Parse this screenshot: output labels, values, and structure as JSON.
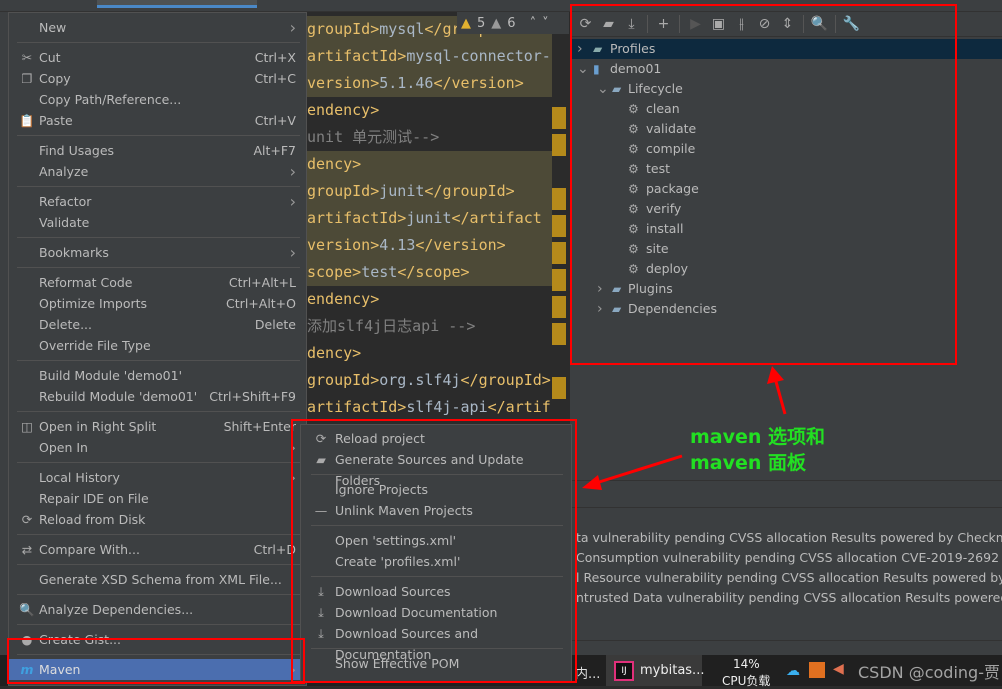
{
  "editor": {
    "warnings": "5",
    "weak_warnings": "6",
    "lines": [
      {
        "parts": [
          [
            "tag",
            "groupId>"
          ],
          [
            "txt",
            "mysql"
          ],
          [
            "tag",
            "</groupId"
          ]
        ],
        "hl": true
      },
      {
        "parts": [
          [
            "tag",
            "artifactId>"
          ],
          [
            "txt",
            "mysql-connector-"
          ]
        ],
        "hl": true
      },
      {
        "parts": [
          [
            "tag",
            "version>"
          ],
          [
            "txt",
            "5.1.46"
          ],
          [
            "tag",
            "</version>"
          ]
        ],
        "hl": true
      },
      {
        "parts": [
          [
            "tag",
            "endency>"
          ]
        ],
        "hl": false
      },
      {
        "parts": [
          [
            "cmt",
            "unit 单元测试-->"
          ]
        ],
        "hl": false
      },
      {
        "parts": [
          [
            "tag",
            "dency>"
          ]
        ],
        "hl": true
      },
      {
        "parts": [
          [
            "tag",
            "groupId>"
          ],
          [
            "txt",
            "junit"
          ],
          [
            "tag",
            "</groupId>"
          ]
        ],
        "hl": true
      },
      {
        "parts": [
          [
            "tag",
            "artifactId>"
          ],
          [
            "txt",
            "junit"
          ],
          [
            "tag",
            "</artifact"
          ]
        ],
        "hl": true
      },
      {
        "parts": [
          [
            "tag",
            "version>"
          ],
          [
            "txt",
            "4.13"
          ],
          [
            "tag",
            "</version>"
          ]
        ],
        "hl": true
      },
      {
        "parts": [
          [
            "tag",
            "scope>"
          ],
          [
            "txt",
            "test"
          ],
          [
            "tag",
            "</scope>"
          ]
        ],
        "hl": true
      },
      {
        "parts": [
          [
            "tag",
            "endency>"
          ]
        ],
        "hl": false
      },
      {
        "parts": [
          [
            "cmt",
            "添加slf4j日志api -->"
          ]
        ],
        "hl": false
      },
      {
        "parts": [
          [
            "tag",
            "dency>"
          ]
        ],
        "hl": false
      },
      {
        "parts": [
          [
            "tag",
            "groupId>"
          ],
          [
            "txt",
            "org.slf4j"
          ],
          [
            "tag",
            "</groupId>"
          ]
        ],
        "hl": false
      },
      {
        "parts": [
          [
            "tag",
            "artifactId>"
          ],
          [
            "txt",
            "slf4j-api"
          ],
          [
            "tag",
            "</artif"
          ]
        ],
        "hl": false
      }
    ]
  },
  "context_menu": {
    "items": [
      {
        "label": "New",
        "arrow": true
      },
      {
        "sep": true
      },
      {
        "label": "Cut",
        "shortcut": "Ctrl+X",
        "icon": "scissors-icon",
        "glyph": "✂"
      },
      {
        "label": "Copy",
        "shortcut": "Ctrl+C",
        "icon": "copy-icon",
        "glyph": "❐"
      },
      {
        "label": "Copy Path/Reference..."
      },
      {
        "label": "Paste",
        "shortcut": "Ctrl+V",
        "icon": "paste-icon",
        "glyph": "📋"
      },
      {
        "sep": true
      },
      {
        "label": "Find Usages",
        "shortcut": "Alt+F7"
      },
      {
        "label": "Analyze",
        "arrow": true
      },
      {
        "sep": true
      },
      {
        "label": "Refactor",
        "arrow": true
      },
      {
        "label": "Validate"
      },
      {
        "sep": true
      },
      {
        "label": "Bookmarks",
        "arrow": true
      },
      {
        "sep": true
      },
      {
        "label": "Reformat Code",
        "shortcut": "Ctrl+Alt+L"
      },
      {
        "label": "Optimize Imports",
        "shortcut": "Ctrl+Alt+O"
      },
      {
        "label": "Delete...",
        "shortcut": "Delete"
      },
      {
        "label": "Override File Type"
      },
      {
        "sep": true
      },
      {
        "label": "Build Module 'demo01'"
      },
      {
        "label": "Rebuild Module 'demo01'",
        "shortcut": "Ctrl+Shift+F9"
      },
      {
        "sep": true
      },
      {
        "label": "Open in Right Split",
        "shortcut": "Shift+Enter",
        "icon": "split-icon",
        "glyph": "◫"
      },
      {
        "label": "Open In",
        "arrow": true
      },
      {
        "sep": true
      },
      {
        "label": "Local History",
        "arrow": true
      },
      {
        "label": "Repair IDE on File"
      },
      {
        "label": "Reload from Disk",
        "icon": "reload-icon",
        "glyph": "⟳"
      },
      {
        "sep": true
      },
      {
        "label": "Compare With...",
        "shortcut": "Ctrl+D",
        "icon": "compare-icon",
        "glyph": "⇄"
      },
      {
        "sep": true
      },
      {
        "label": "Generate XSD Schema from XML File..."
      },
      {
        "sep": true
      },
      {
        "label": "Analyze Dependencies...",
        "icon": "analyze-icon",
        "glyph": "🔍"
      },
      {
        "sep": true
      },
      {
        "label": "Create Gist...",
        "icon": "github-icon",
        "glyph": "●"
      },
      {
        "sep": true
      },
      {
        "label": "Maven",
        "arrow": true,
        "selected": true,
        "icon": "maven-icon",
        "glyph": "m"
      }
    ]
  },
  "maven_submenu": {
    "items": [
      {
        "label": "Reload project",
        "icon": "reload-icon",
        "glyph": "⟳"
      },
      {
        "label": "Generate Sources and Update Folders",
        "icon": "folder-sync-icon",
        "glyph": "▰"
      },
      {
        "sep": true
      },
      {
        "label": "Ignore Projects"
      },
      {
        "label": "Unlink Maven Projects",
        "icon": "minus-icon",
        "glyph": "—"
      },
      {
        "sep": true
      },
      {
        "label": "Open 'settings.xml'"
      },
      {
        "label": "Create 'profiles.xml'"
      },
      {
        "sep": true
      },
      {
        "label": "Download Sources",
        "icon": "download-icon",
        "glyph": "⤓"
      },
      {
        "label": "Download Documentation",
        "icon": "download-icon",
        "glyph": "⤓"
      },
      {
        "label": "Download Sources and Documentation",
        "icon": "download-icon",
        "glyph": "⤓"
      },
      {
        "sep": true
      },
      {
        "label": "Show Effective POM"
      }
    ]
  },
  "maven_panel": {
    "toolbar": [
      {
        "icon": "reload-icon",
        "glyph": "⟳"
      },
      {
        "icon": "generate-sources-icon",
        "glyph": "▰"
      },
      {
        "icon": "download-icon",
        "glyph": "⤓"
      },
      {
        "sep": true
      },
      {
        "icon": "add-icon",
        "glyph": "+"
      },
      {
        "sep": true
      },
      {
        "icon": "run-icon",
        "glyph": "▶"
      },
      {
        "icon": "execute-goal-icon",
        "glyph": "▣"
      },
      {
        "icon": "toggle-offline-icon",
        "glyph": "⫲"
      },
      {
        "icon": "skip-tests-icon",
        "glyph": "⊘"
      },
      {
        "icon": "collapse-all-icon",
        "glyph": "⇕"
      },
      {
        "sep": true
      },
      {
        "icon": "analyze-dependencies-icon",
        "glyph": "🔍"
      },
      {
        "sep": true
      },
      {
        "icon": "settings-wrench-icon",
        "glyph": "🔧"
      }
    ],
    "tree": [
      {
        "label": "Profiles",
        "level": 0,
        "chevron": "›",
        "icon": "profiles-icon",
        "selected": true
      },
      {
        "label": "demo01",
        "level": 0,
        "chevron": "⌄",
        "icon": "maven-project-icon"
      },
      {
        "label": "Lifecycle",
        "level": 1,
        "chevron": "⌄",
        "icon": "lifecycle-folder-icon"
      },
      {
        "label": "clean",
        "level": 2,
        "icon": "gear-icon"
      },
      {
        "label": "validate",
        "level": 2,
        "icon": "gear-icon"
      },
      {
        "label": "compile",
        "level": 2,
        "icon": "gear-icon"
      },
      {
        "label": "test",
        "level": 2,
        "icon": "gear-icon"
      },
      {
        "label": "package",
        "level": 2,
        "icon": "gear-icon"
      },
      {
        "label": "verify",
        "level": 2,
        "icon": "gear-icon"
      },
      {
        "label": "install",
        "level": 2,
        "icon": "gear-icon"
      },
      {
        "label": "site",
        "level": 2,
        "icon": "gear-icon"
      },
      {
        "label": "deploy",
        "level": 2,
        "icon": "gear-icon"
      },
      {
        "label": "Plugins",
        "level": 1,
        "chevron": "›",
        "icon": "plugins-folder-icon"
      },
      {
        "label": "Dependencies",
        "level": 1,
        "chevron": "›",
        "icon": "dependencies-folder-icon"
      }
    ]
  },
  "bottom_panel": {
    "lines": [
      "ta vulnerability pending CVSS allocation  Results powered by Checkmarx(c)",
      "Consumption vulnerability pending CVSS allocation CVE-2019-2692 6.3 Im",
      "l Resource vulnerability pending CVSS allocation  Results powered by Che",
      "ntrusted Data vulnerability pending CVSS allocation  Results powered by C"
    ]
  },
  "taskbar": {
    "app_label": "mybitas...",
    "cpu_percent": "14%",
    "cpu_label": "CPU负载",
    "watermark": "CSDN @coding-贾",
    "left_fragment": "内..."
  },
  "annotation": {
    "line1": "maven 选项和",
    "line2": "maven 面板",
    "color": "#22e022"
  }
}
